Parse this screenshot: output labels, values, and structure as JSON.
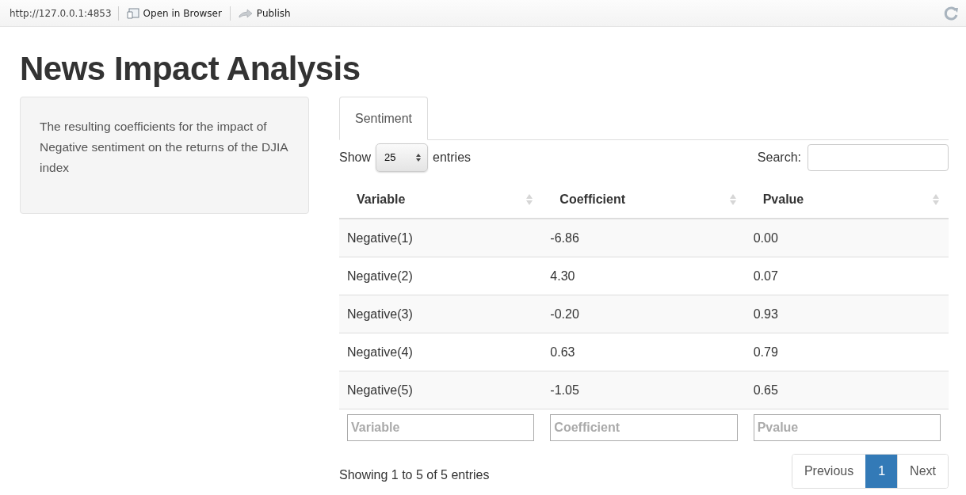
{
  "toolbar": {
    "url": "http://127.0.0.1:4853",
    "buttons": [
      "Open in Browser",
      "Publish"
    ]
  },
  "title": "News Impact Analysis",
  "sidebar": {
    "text": "The resulting coefficients for the impact of Negative sentiment on the returns of the DJIA index"
  },
  "tabs": [
    {
      "label": "Sentiment",
      "selected": true
    }
  ],
  "length_control": {
    "before": "Show",
    "value": "25",
    "after": "entries"
  },
  "search": {
    "label": "Search:"
  },
  "table": {
    "columns": [
      "Variable",
      "Coefficient",
      "Pvalue"
    ],
    "rows": [
      [
        "Negative(1)",
        "-6.86",
        "0.00"
      ],
      [
        "Negative(2)",
        "4.30",
        "0.07"
      ],
      [
        "Negative(3)",
        "-0.20",
        "0.93"
      ],
      [
        "Negative(4)",
        "0.63",
        "0.79"
      ],
      [
        "Negative(5)",
        "-1.05",
        "0.65"
      ]
    ],
    "filters": [
      {
        "placeholder": "Variable"
      },
      {
        "placeholder": "Coefficient"
      },
      {
        "placeholder": "Pvalue"
      }
    ]
  },
  "info": "Showing 1 to 5 of 5 entries",
  "pagination": [
    {
      "label": "Previous",
      "selected": false
    },
    {
      "label": "1",
      "selected": true
    },
    {
      "label": "Next",
      "selected": false
    }
  ]
}
